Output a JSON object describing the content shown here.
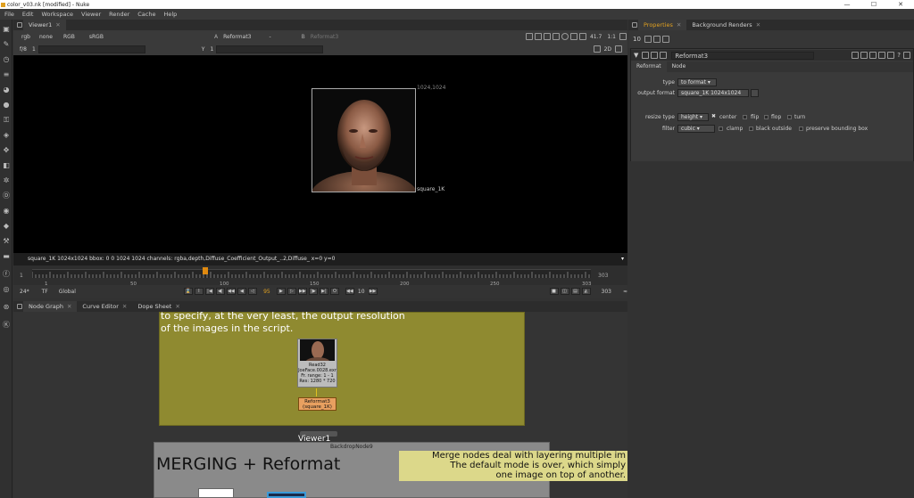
{
  "window": {
    "title": "color_v03.nk [modified] - Nuke",
    "controls": [
      "—",
      "☐",
      "✕"
    ]
  },
  "menu": [
    "File",
    "Edit",
    "Workspace",
    "Viewer",
    "Render",
    "Cache",
    "Help"
  ],
  "toolbar_icons": [
    "image-icon",
    "draw-icon",
    "time-icon",
    "channel-icon",
    "color-icon",
    "filter-icon",
    "keyer-icon",
    "merge-icon",
    "transform-icon",
    "3d-icon",
    "particles-icon",
    "deep-icon",
    "views-icon",
    "metadata-icon",
    "toolsets-icon",
    "other-icon",
    "furnace-icon",
    "ocula-icon",
    "cara-icon"
  ],
  "viewer": {
    "tab": "Viewer1",
    "channels": "rgb",
    "alpha": "none",
    "display": "RGB",
    "colorspace": "sRGB",
    "input_a": "Reformat3",
    "input_a_sep": "-",
    "input_b": "Reformat3",
    "zoom": "41.7",
    "scale": "1:1",
    "fstop": "f/8",
    "gain": "1",
    "gamma_label": "Y",
    "gamma": "1",
    "mode": "2D",
    "resolution": "1024,1024",
    "format": "square_1K",
    "info": "square_1K 1024x1024  bbox: 0 0 1024 1024 channels: rgba,depth,Diffuse_Coefficient_Output_..2,Diffuse_  x=0 y=0"
  },
  "timeline": {
    "start": "1",
    "end": "303",
    "ticks": [
      "1",
      "50",
      "100",
      "150",
      "200",
      "250",
      "303"
    ],
    "fps": "24*",
    "tf": "TF",
    "global": "Global",
    "frame": "95",
    "incr": "10",
    "end_field": "303",
    "tl_end": "303",
    "current": 0.31
  },
  "nodegraph": {
    "tabs": [
      "Node Graph",
      "Curve Editor",
      "Dope Sheet"
    ],
    "backdrop_text_1": "to specify, at the very least, the output resolution",
    "backdrop_text_2": "of the images in the script.",
    "read_node": {
      "name": "Read32",
      "file": "JoeFace.0028.exr",
      "range": "Fr. range: 1 - 1",
      "res": "Res: 1280 * 720"
    },
    "reformat_node": {
      "name": "Reformat3",
      "sub": "(square_1K)"
    },
    "viewer_node": "Viewer1",
    "backdrop2_name": "BackdropNode9",
    "backdrop2_title": "MERGING + Reformat",
    "sticky_1": "Merge nodes deal with layering multiple im",
    "sticky_2": "The default mode is over, which simply",
    "sticky_3": "one image on top of another."
  },
  "properties": {
    "tabs": [
      "Properties",
      "Background Renders"
    ],
    "max_panels": "10",
    "node_name": "Reformat3",
    "subtabs": [
      "Reformat",
      "Node"
    ],
    "type_label": "type",
    "type_value": "to format",
    "output_format_label": "output format",
    "output_format_value": "square_1K 1024x1024",
    "resize_label": "resize type",
    "resize_value": "height",
    "center_label": "center",
    "flip_label": "flip",
    "flop_label": "flop",
    "turn_label": "turn",
    "filter_label": "filter",
    "filter_value": "cubic",
    "clamp_label": "clamp",
    "black_outside_label": "black outside",
    "preserve_bbox_label": "preserve bounding box",
    "center_checked": true
  }
}
